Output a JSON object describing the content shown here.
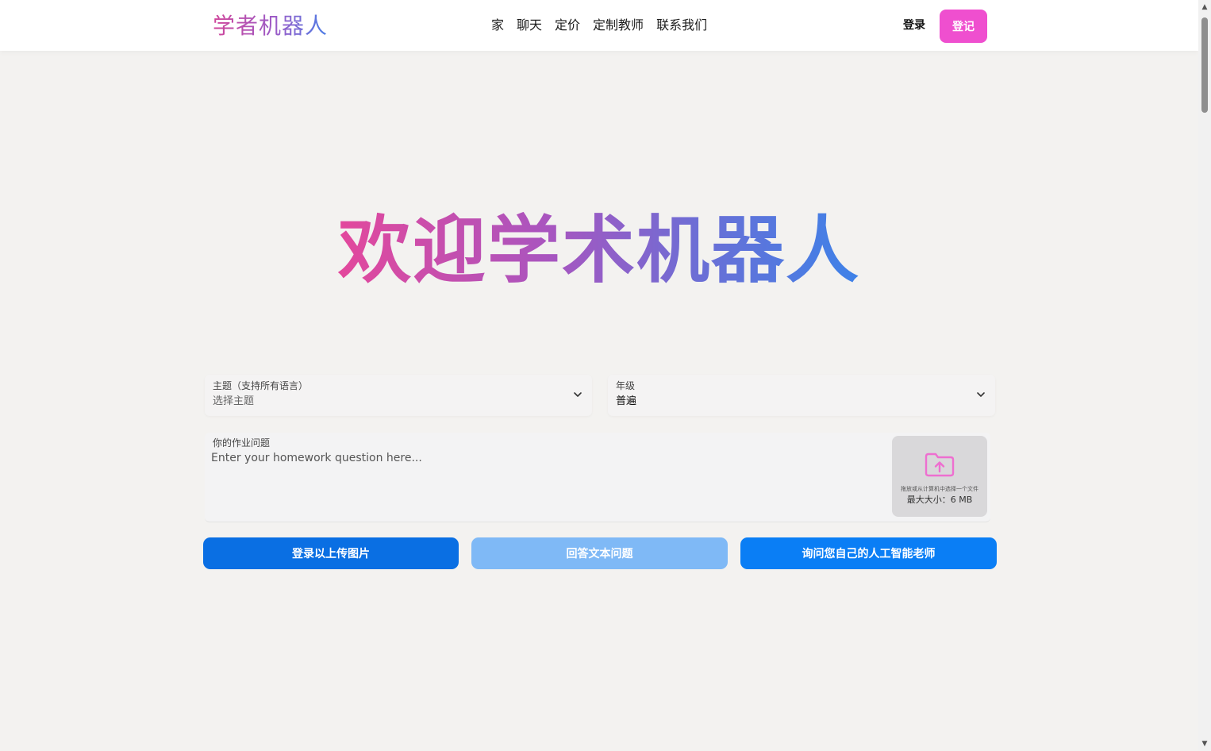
{
  "header": {
    "logo": "学者机器人",
    "nav": [
      "家",
      "聊天",
      "定价",
      "定制教师",
      "联系我们"
    ],
    "login": "登录",
    "signup": "登记"
  },
  "hero": {
    "title": "欢迎学术机器人"
  },
  "form": {
    "subject": {
      "label": "主题（支持所有语言）",
      "value": "选择主题"
    },
    "grade": {
      "label": "年级",
      "value": "普遍"
    },
    "homework": {
      "label": "你的作业问题",
      "placeholder": "Enter your homework question here..."
    },
    "upload": {
      "hint": "拖放或从计算机中选择一个文件",
      "max_size": "最大大小：6 MB"
    }
  },
  "buttons": {
    "upload_image": "登录以上传图片",
    "answer_text": "回答文本问题",
    "ask_tutor": "询问您自己的人工智能老师"
  },
  "colors": {
    "signup": "#ef4fcf",
    "primary_blue": "#0a6fe3",
    "disabled_blue": "#7fb9f6",
    "gradient_start": "#e3489c",
    "gradient_end": "#3d82e8"
  }
}
